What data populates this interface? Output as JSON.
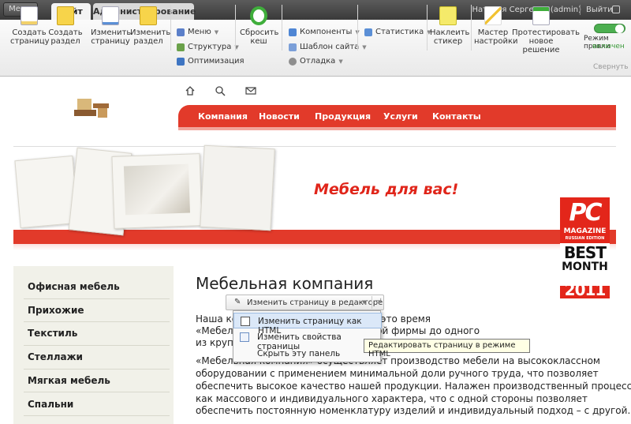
{
  "topbar": {
    "menu_label": "Меню",
    "tabs": [
      {
        "label": "Сайт"
      },
      {
        "label": "Администрирование"
      }
    ],
    "user": "Наталья Сергеева (admin)",
    "logout": "Выйти"
  },
  "toolbar": {
    "buttons": [
      {
        "label1": "Создать",
        "label2": "страницу",
        "icon": "new-page-icon"
      },
      {
        "label1": "Создать",
        "label2": "раздел",
        "icon": "new-folder-icon"
      },
      {
        "label1": "Изменить",
        "label2": "страницу",
        "icon": "edit-page-icon"
      },
      {
        "label1": "Изменить",
        "label2": "раздел",
        "icon": "edit-folder-icon"
      },
      {
        "label1": "Сбросить",
        "label2": "кеш",
        "icon": "refresh-icon"
      },
      {
        "label1": "Наклеить",
        "label2": "стикер",
        "icon": "sticker-icon"
      },
      {
        "label1": "Мастер",
        "label2": "настройки",
        "icon": "wizard-icon"
      },
      {
        "label1": "Протестировать",
        "label2": "новое решение",
        "icon": "test-icon"
      }
    ],
    "small": [
      {
        "label": "Меню",
        "icon": "menu-icon"
      },
      {
        "label": "Структура",
        "icon": "structure-icon"
      },
      {
        "label": "Оптимизация",
        "icon": "seo-icon"
      },
      {
        "label": "Компоненты",
        "icon": "components-icon"
      },
      {
        "label": "Шаблон сайта",
        "icon": "template-icon"
      },
      {
        "label": "Отладка",
        "icon": "debug-icon"
      },
      {
        "label": "Статистика",
        "icon": "stats-icon"
      }
    ],
    "edit_mode": {
      "label1": "Режим правки",
      "label2": "включен"
    },
    "collapse": "Свернуть"
  },
  "site": {
    "nav": [
      "Компания",
      "Новости",
      "Продукция",
      "Услуги",
      "Контакты"
    ],
    "tagline": "Мебель для вас!",
    "badge": {
      "line1": "PC",
      "line2": "MAGAZINE",
      "line3": "RUSSIAN EDITION",
      "line4": "BEST",
      "line5": "MONTH",
      "line6": "2011"
    },
    "sidebar": [
      "Офисная мебель",
      "Прихожие",
      "Текстиль",
      "Стеллажи",
      "Мягкая мебель",
      "Спальни"
    ],
    "heading": "Мебельная компания",
    "para1_lines": [
      "Наша ко                                       ском рынке с 1992 года. За это время",
      "«Мебел                                                   й путь от маленькой торговой фирмы до одного",
      "из круп                                           ной мебели в России."
    ],
    "para2_lines": [
      "«Мебельная компания» осуществляет производство мебели на высококлассном",
      "оборудовании с применением минимальной доли ручного труда, что позволяет",
      "обеспечить высокое качество нашей продукции. Налажен производственный процесс",
      "как массового и индивидуального характера, что с одной стороны позволяет",
      "обеспечить постоянную номенклатуру изделий и индивидуальный подход – с другой."
    ]
  },
  "popup": {
    "button": "Изменить страницу в редакторе",
    "items": [
      "Изменить страницу как HTML",
      "Изменить свойства страницы",
      "Скрыть эту панель"
    ],
    "tooltip": "Редактировать страницу в режиме HTML"
  }
}
